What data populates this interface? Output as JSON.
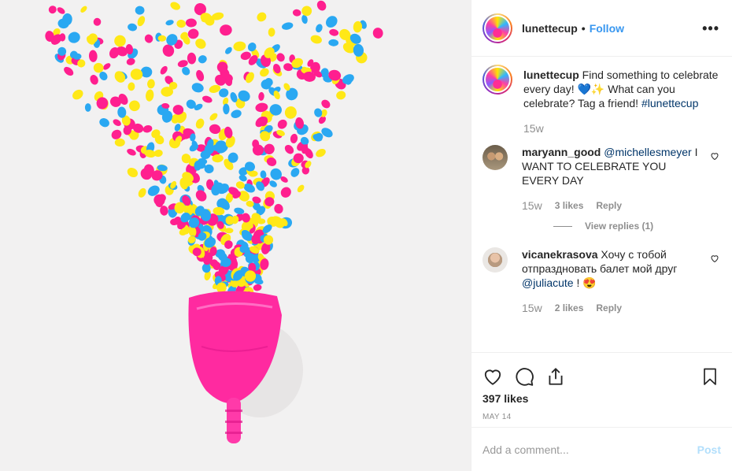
{
  "post": {
    "author": "lunettecup",
    "follow_label": "Follow",
    "separator": "•",
    "more_glyph": "•••",
    "photo": {
      "subject": "pink menstrual cup with confetti",
      "colors": [
        "#ff1f8f",
        "#ffe817",
        "#2aa8f2"
      ]
    },
    "caption": {
      "username": "lunettecup",
      "text": "Find something to celebrate every day! 💙✨ What can you celebrate? Tag a friend!",
      "hashtag": "#lunettecup",
      "age": "15w"
    },
    "comments": [
      {
        "username": "maryann_good",
        "mention": "@michellesmeyer",
        "text": "I WANT TO CELEBRATE YOU EVERY DAY",
        "age": "15w",
        "likes": "3 likes",
        "reply": "Reply",
        "view_replies": "View replies (1)"
      },
      {
        "username": "vicanekrasova",
        "text": "Хочу с тобой отпраздновать балет мой друг",
        "mention": "@juliacute",
        "emoji": "! 😍",
        "age": "15w",
        "likes": "2 likes",
        "reply": "Reply"
      }
    ],
    "likes_count": "397 likes",
    "date": "MAY 14",
    "add_comment_placeholder": "Add a comment...",
    "post_label": "Post",
    "icons": [
      "heart-icon",
      "comment-icon",
      "share-icon",
      "bookmark-icon",
      "more-icon"
    ],
    "accent": "#3897f0"
  }
}
